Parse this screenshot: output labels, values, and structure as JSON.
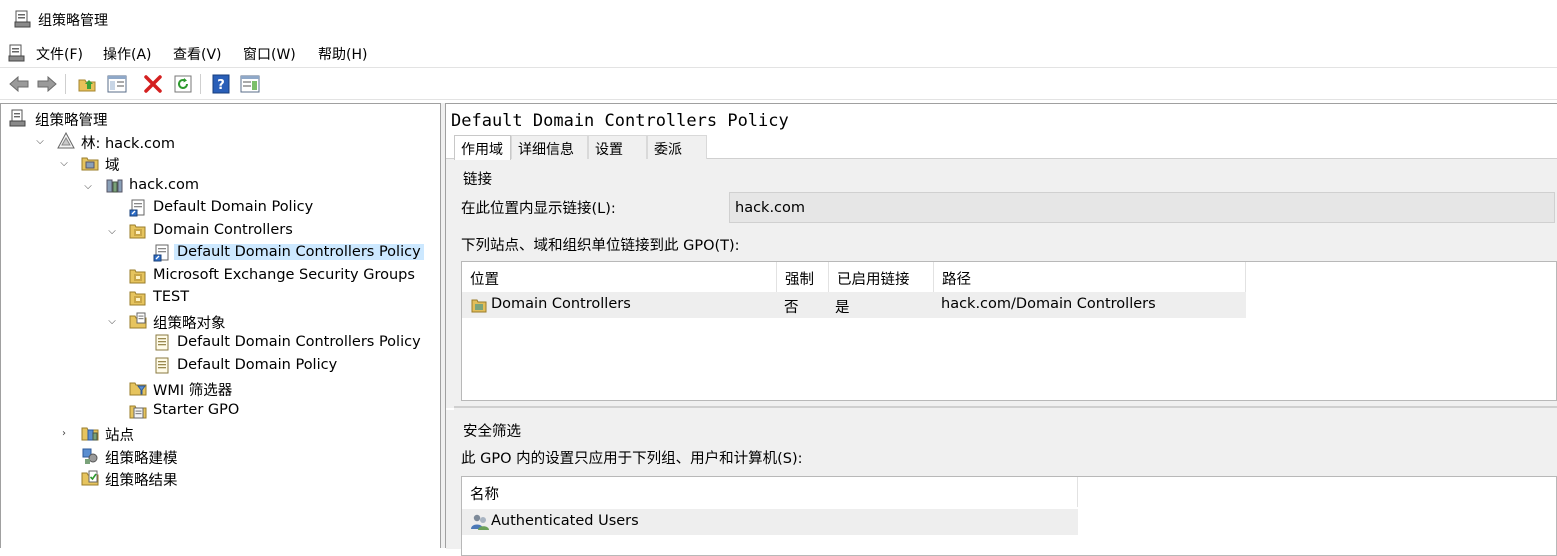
{
  "window": {
    "title": "组策略管理"
  },
  "menu": {
    "items": [
      "文件(F)",
      "操作(A)",
      "查看(V)",
      "窗口(W)",
      "帮助(H)"
    ]
  },
  "toolbar": {
    "buttons": [
      "back-icon",
      "forward-icon",
      "up-folder-icon",
      "show-hide-tree-icon",
      "delete-icon",
      "refresh-icon",
      "help-icon",
      "properties-pane-icon"
    ]
  },
  "tree": {
    "items": [
      {
        "label": "组策略管理",
        "icon": "gpm-icon"
      },
      {
        "label": "林: hack.com",
        "icon": "forest-icon"
      },
      {
        "label": "域",
        "icon": "domains-icon"
      },
      {
        "label": "hack.com",
        "icon": "domain-icon"
      },
      {
        "label": "Default Domain Policy",
        "icon": "gpo-link-icon"
      },
      {
        "label": "Domain Controllers",
        "icon": "ou-icon"
      },
      {
        "label": "Default Domain Controllers Policy",
        "icon": "gpo-link-icon"
      },
      {
        "label": "Microsoft Exchange Security Groups",
        "icon": "ou-icon"
      },
      {
        "label": "TEST",
        "icon": "ou-icon"
      },
      {
        "label": "组策略对象",
        "icon": "gpo-folder-icon"
      },
      {
        "label": "Default Domain Controllers Policy",
        "icon": "gpo-icon"
      },
      {
        "label": "Default Domain Policy",
        "icon": "gpo-icon"
      },
      {
        "label": "WMI 筛选器",
        "icon": "wmi-folder-icon"
      },
      {
        "label": "Starter GPO",
        "icon": "starter-gpo-icon"
      },
      {
        "label": "站点",
        "icon": "sites-icon"
      },
      {
        "label": "组策略建模",
        "icon": "modeling-icon"
      },
      {
        "label": "组策略结果",
        "icon": "results-icon"
      }
    ]
  },
  "details": {
    "title": "Default Domain Controllers Policy",
    "tabs": [
      "作用域",
      "详细信息",
      "设置",
      "委派"
    ],
    "links_heading": "链接",
    "show_links_label": "在此位置内显示链接(L):",
    "show_links_value": "hack.com",
    "linked_label": "下列站点、域和组织单位链接到此 GPO(T):",
    "links_columns": [
      "位置",
      "强制",
      "已启用链接",
      "路径"
    ],
    "links_rows": [
      {
        "location": "Domain Controllers",
        "enforced": "否",
        "enabled": "是",
        "path": "hack.com/Domain Controllers"
      }
    ],
    "security_heading": "安全筛选",
    "security_label": "此 GPO 内的设置只应用于下列组、用户和计算机(S):",
    "security_columns": [
      "名称"
    ],
    "security_rows": [
      {
        "name": "Authenticated Users"
      }
    ]
  },
  "colors": {
    "selection": "#cce8ff",
    "pane_bg": "#f0f0f0",
    "field_bg": "#e6e6e6"
  }
}
